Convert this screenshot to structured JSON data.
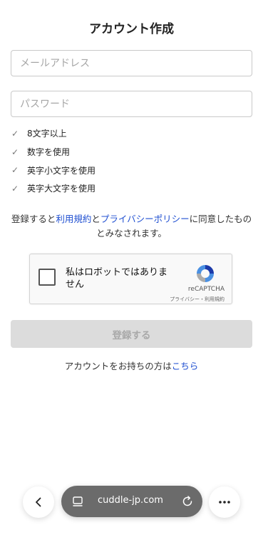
{
  "page": {
    "title": "アカウント作成"
  },
  "form": {
    "email_placeholder": "メールアドレス",
    "password_placeholder": "パスワード"
  },
  "password_rules": [
    {
      "label": "8文字以上"
    },
    {
      "label": "数字を使用"
    },
    {
      "label": "英字小文字を使用"
    },
    {
      "label": "英字大文字を使用"
    }
  ],
  "agreement": {
    "prefix": "登録すると",
    "terms_link": "利用規約",
    "and": "と",
    "privacy_link": "プライバシーポリシー",
    "suffix": "に同意したものとみなされます。"
  },
  "captcha": {
    "label": "私はロボットではありません",
    "brand": "reCAPTCHA",
    "links": "プライバシー・利用規約"
  },
  "submit": {
    "label": "登録する"
  },
  "login_prompt": {
    "text": "アカウントをお持ちの方は",
    "link": "こちら"
  },
  "browser": {
    "url": "cuddle-jp.com",
    "icons": [
      "back-icon",
      "tab-list-icon",
      "reload-icon",
      "more-icon"
    ]
  },
  "colors": {
    "link": "#1f4fd1",
    "button_disabled_bg": "#dcdcdc",
    "button_disabled_text": "#a9a9a9",
    "urlbar_bg": "#6b6b6b"
  }
}
